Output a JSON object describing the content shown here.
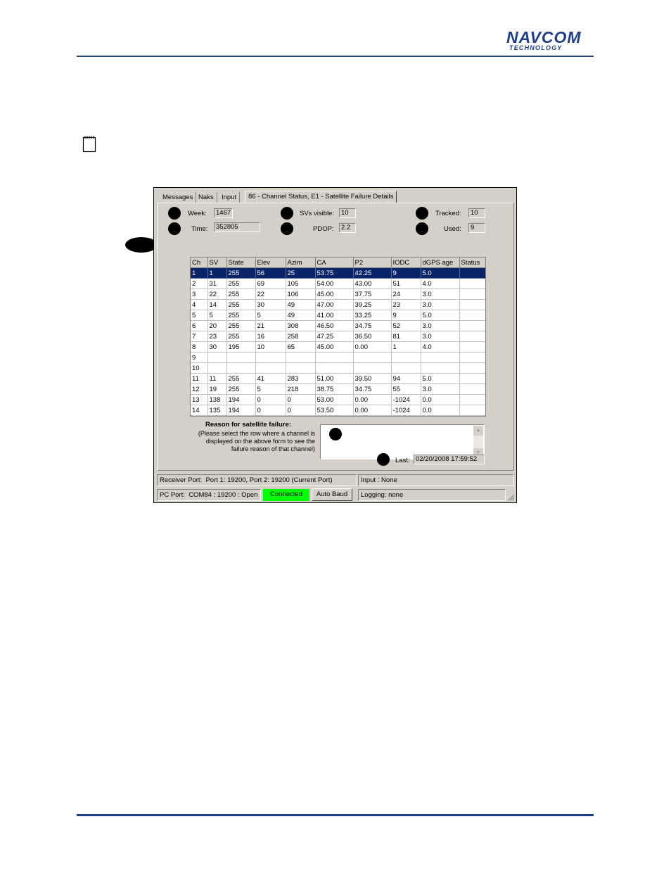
{
  "logo": {
    "top": "NAVCOM",
    "bottom": "TECHNOLOGY"
  },
  "tabs": [
    "Messages",
    "Naks",
    "Input",
    "86 - Channel Status, E1 - Satellite Failure Details"
  ],
  "fields": {
    "week": {
      "label": "Week:",
      "value": "1467"
    },
    "time": {
      "label": "Time:",
      "value": "352805"
    },
    "svs_visible": {
      "label": "SVs visible:",
      "value": "10"
    },
    "pdop": {
      "label": "PDOP:",
      "value": "2.2"
    },
    "tracked": {
      "label": "Tracked:",
      "value": "10"
    },
    "used": {
      "label": "Used:",
      "value": "9"
    }
  },
  "table": {
    "columns": [
      "Ch",
      "SV",
      "State",
      "Elev",
      "Azim",
      "CA",
      "P2",
      "IODC",
      "dGPS age",
      "Status"
    ],
    "rows": [
      [
        "1",
        "1",
        "255",
        "56",
        "25",
        "53.75",
        "42.25",
        "9",
        "5.0",
        ""
      ],
      [
        "2",
        "31",
        "255",
        "69",
        "105",
        "54.00",
        "43.00",
        "51",
        "4.0",
        ""
      ],
      [
        "3",
        "22",
        "255",
        "22",
        "106",
        "45.00",
        "37.75",
        "24",
        "3.0",
        ""
      ],
      [
        "4",
        "14",
        "255",
        "30",
        "49",
        "47.00",
        "39.25",
        "23",
        "3.0",
        ""
      ],
      [
        "5",
        "5",
        "255",
        "5",
        "49",
        "41.00",
        "33.25",
        "9",
        "5.0",
        ""
      ],
      [
        "6",
        "20",
        "255",
        "21",
        "308",
        "46.50",
        "34.75",
        "52",
        "3.0",
        ""
      ],
      [
        "7",
        "23",
        "255",
        "16",
        "258",
        "47.25",
        "36.50",
        "81",
        "3.0",
        ""
      ],
      [
        "8",
        "30",
        "195",
        "10",
        "65",
        "45.00",
        "0.00",
        "1",
        "4.0",
        ""
      ],
      [
        "9",
        "",
        "",
        "",
        "",
        "",
        "",
        "",
        "",
        ""
      ],
      [
        "10",
        "",
        "",
        "",
        "",
        "",
        "",
        "",
        "",
        ""
      ],
      [
        "11",
        "11",
        "255",
        "41",
        "283",
        "51.00",
        "39.50",
        "94",
        "5.0",
        ""
      ],
      [
        "12",
        "19",
        "255",
        "5",
        "218",
        "38.75",
        "34.75",
        "55",
        "3.0",
        ""
      ],
      [
        "13",
        "138",
        "194",
        "0",
        "0",
        "53.00",
        "0.00",
        "-1024",
        "0.0",
        ""
      ],
      [
        "14",
        "135",
        "194",
        "0",
        "0",
        "53.50",
        "0.00",
        "-1024",
        "0.0",
        ""
      ]
    ]
  },
  "reason": {
    "title": "Reason for satellite failure:",
    "help": "(Please select the row where a channel is displayed on the above form to see the failure reason of that channel)",
    "text": ""
  },
  "last": {
    "label": "Last:",
    "value": "02/20/2008 17:59:52"
  },
  "statusbar": {
    "receiver_port_label": "Receiver Port:",
    "receiver_port_value": "Port 1: 19200, Port 2: 19200 (Current Port)",
    "input": "Input : None",
    "pc_port_label": "PC Port:",
    "pc_port_value": "COM84 : 19200 : Open",
    "connected": "Connected",
    "auto_baud": "Auto Baud",
    "logging": "Logging: none"
  },
  "colors": {
    "brand": "#1e3f8a",
    "selection": "#0a246a",
    "connected": "#00ff00",
    "arrow": "#e00000"
  }
}
